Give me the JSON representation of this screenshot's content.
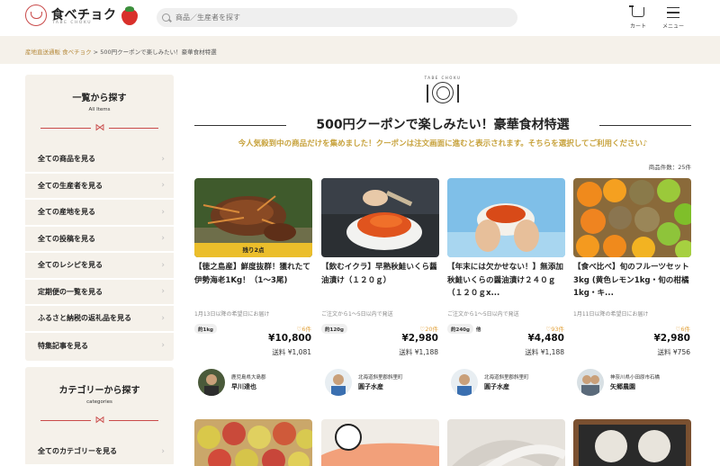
{
  "header": {
    "logo_text": "食べチョク",
    "logo_sub": "TABE CHOKU",
    "search_placeholder": "商品／生産者を探す",
    "cart_label": "カート",
    "menu_label": "メニュー"
  },
  "breadcrumb": {
    "home": "産地直送通販 食べチョク",
    "separator": ">",
    "current": "500円クーポンで楽しみたい！豪華食材特選"
  },
  "sidebar": {
    "all_items": {
      "title": "一覧から探す",
      "subtitle": "All Items",
      "items": [
        {
          "label": "全ての商品を見る"
        },
        {
          "label": "全ての生産者を見る"
        },
        {
          "label": "全ての産地を見る"
        },
        {
          "label": "全ての投稿を見る"
        },
        {
          "label": "全てのレシピを見る"
        },
        {
          "label": "定期便の一覧を見る"
        },
        {
          "label": "ふるさと納税の返礼品を見る"
        },
        {
          "label": "特集記事を見る"
        }
      ]
    },
    "categories": {
      "title": "カテゴリーから探す",
      "subtitle": "categories",
      "items": [
        {
          "label": "全てのカテゴリーを見る"
        }
      ]
    }
  },
  "main": {
    "logo_sub": "TABE CHOKU",
    "title": "500円クーポンで楽しみたい！豪華食材特選",
    "lead": "今人気殺到中の商品だけを集めました！クーポンは注文画面に進むと表示されます。そちらを選択してご利用ください♪",
    "item_count": "商品件数：25件",
    "products": [
      {
        "badge": "残り2点",
        "title": "【徳之島産】鮮度抜群！獲れたて伊勢海老1Kg！（1〜3尾)",
        "shipping": "1月13日以降の希望日にお届け",
        "tags": [
          "約1kg"
        ],
        "favorites": "6件",
        "price": "¥10,800",
        "fee": "送料 ¥1,081",
        "producer_location": "鹿児島県大島郡",
        "producer_name": "早川達也"
      },
      {
        "badge": "",
        "title": "【飲むイクラ】早熟秋鮭いくら醤油漬け（１２０ｇ）",
        "shipping": "ご注文から1〜5日以内で発送",
        "tags": [
          "約120g"
        ],
        "favorites": "20件",
        "price": "¥2,980",
        "fee": "送料 ¥1,188",
        "producer_location": "北海道斜里郡斜里町",
        "producer_name": "圓子水産"
      },
      {
        "badge": "",
        "title": "【年末には欠かせない！】無添加秋鮭いくらの醤油漬け２４０ｇ（１２０ｇx...",
        "shipping": "ご注文から1〜5日以内で発送",
        "tags": [
          "約240g",
          "他"
        ],
        "favorites": "93件",
        "price": "¥4,480",
        "fee": "送料 ¥1,188",
        "producer_location": "北海道斜里郡斜里町",
        "producer_name": "圓子水産"
      },
      {
        "badge": "",
        "title": "【食べ比べ】旬のフルーツセット 3kg (黄色レモン1kg・旬の柑橘1kg・キ...",
        "shipping": "1月11日以降の希望日にお届け",
        "tags": [],
        "favorites": "6件",
        "price": "¥2,980",
        "fee": "送料 ¥756",
        "producer_location": "神奈川県小田原市石橋",
        "producer_name": "矢郷農園"
      }
    ]
  },
  "colors": {
    "accent_red": "#c94a4a",
    "lead_gold": "#c7a23c",
    "sidebar_bg": "#f5f1ea",
    "badge_yellow": "#f5c428"
  }
}
